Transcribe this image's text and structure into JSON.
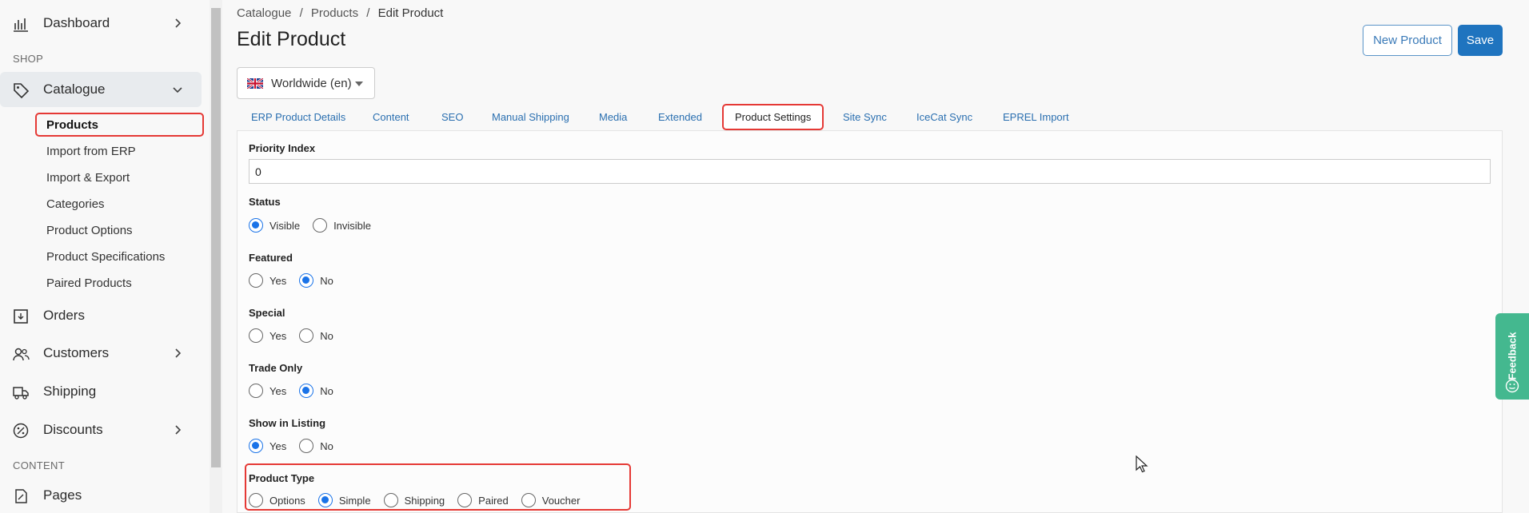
{
  "sidebar": {
    "dashboard": "Dashboard",
    "section_shop": "SHOP",
    "catalogue": "Catalogue",
    "sub_items": [
      "Products",
      "Import from ERP",
      "Import & Export",
      "Categories",
      "Product Options",
      "Product Specifications",
      "Paired Products"
    ],
    "orders": "Orders",
    "customers": "Customers",
    "shipping": "Shipping",
    "discounts": "Discounts",
    "section_content": "CONTENT",
    "pages": "Pages"
  },
  "breadcrumb": [
    "Catalogue",
    "/",
    "Products",
    "/",
    "Edit Product"
  ],
  "page_title": "Edit Product",
  "buttons": {
    "new_product": "New Product",
    "save": "Save"
  },
  "locale": {
    "selected": "Worldwide (en)"
  },
  "tabs": [
    "ERP Product Details",
    "Content",
    "SEO",
    "Manual Shipping",
    "Media",
    "Extended",
    "Product Settings",
    "Site Sync",
    "IceCat Sync",
    "EPREL Import"
  ],
  "active_tab": "Product Settings",
  "form": {
    "priority_index": {
      "label": "Priority Index",
      "value": "0"
    },
    "status": {
      "label": "Status",
      "options": [
        "Visible",
        "Invisible"
      ],
      "selected": "Visible"
    },
    "featured": {
      "label": "Featured",
      "options": [
        "Yes",
        "No"
      ],
      "selected": "No"
    },
    "special": {
      "label": "Special",
      "options": [
        "Yes",
        "No"
      ],
      "selected": ""
    },
    "trade_only": {
      "label": "Trade Only",
      "options": [
        "Yes",
        "No"
      ],
      "selected": "No"
    },
    "show_in_listing": {
      "label": "Show in Listing",
      "options": [
        "Yes",
        "No"
      ],
      "selected": "Yes"
    },
    "product_type": {
      "label": "Product Type",
      "options": [
        "Options",
        "Simple",
        "Shipping",
        "Paired",
        "Voucher"
      ],
      "selected": "Simple"
    }
  },
  "feedback": "Feedback",
  "colors": {
    "accent": "#1f74bf",
    "highlight": "#e53935",
    "feedback": "#44b88f"
  }
}
